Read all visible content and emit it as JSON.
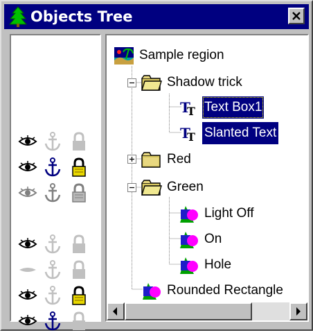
{
  "window": {
    "title": "Objects Tree",
    "title_icon": "tree-icon",
    "close_icon": "close-icon"
  },
  "status_rows": [
    {
      "eye": "on",
      "anchor": "off",
      "lock": "off"
    },
    {
      "eye": "on",
      "anchor": "on",
      "lock": "on"
    },
    {
      "eye": "dim",
      "anchor": "dim",
      "lock": "dim"
    },
    {
      "eye": "on",
      "anchor": "off",
      "lock": "off"
    },
    {
      "eye": "hidden",
      "anchor": "off",
      "lock": "off"
    },
    {
      "eye": "on",
      "anchor": "off",
      "lock": "on"
    },
    {
      "eye": "on",
      "anchor": "on",
      "lock": "off"
    }
  ],
  "tree": {
    "root": {
      "label": "Sample region",
      "icon": "region-icon"
    },
    "shadow_trick": {
      "label": "Shadow trick",
      "icon": "folder-icon",
      "expanded": true
    },
    "text_box1": {
      "label": "Text Box1",
      "icon": "text-icon",
      "selected": true
    },
    "slanted_text": {
      "label": "Slanted Text",
      "icon": "text-icon",
      "selected": true
    },
    "red": {
      "label": "Red",
      "icon": "folder-icon",
      "expanded": false
    },
    "green": {
      "label": "Green",
      "icon": "folder-icon",
      "expanded": true
    },
    "light_off": {
      "label": "Light Off",
      "icon": "shape-icon"
    },
    "on": {
      "label": "On",
      "icon": "shape-icon"
    },
    "hole": {
      "label": "Hole",
      "icon": "shape-icon"
    },
    "rounded_rectangle": {
      "label": "Rounded Rectangle",
      "icon": "shape-icon"
    }
  },
  "colors": {
    "titlebar": "#000080",
    "selection": "#000080",
    "folder": "#d8c860",
    "anchor_on": "#000080",
    "lock_on": "#e8d800",
    "shape_blue": "#1e1ec8",
    "shape_magenta": "#ff00ff",
    "shape_green": "#00a000"
  }
}
